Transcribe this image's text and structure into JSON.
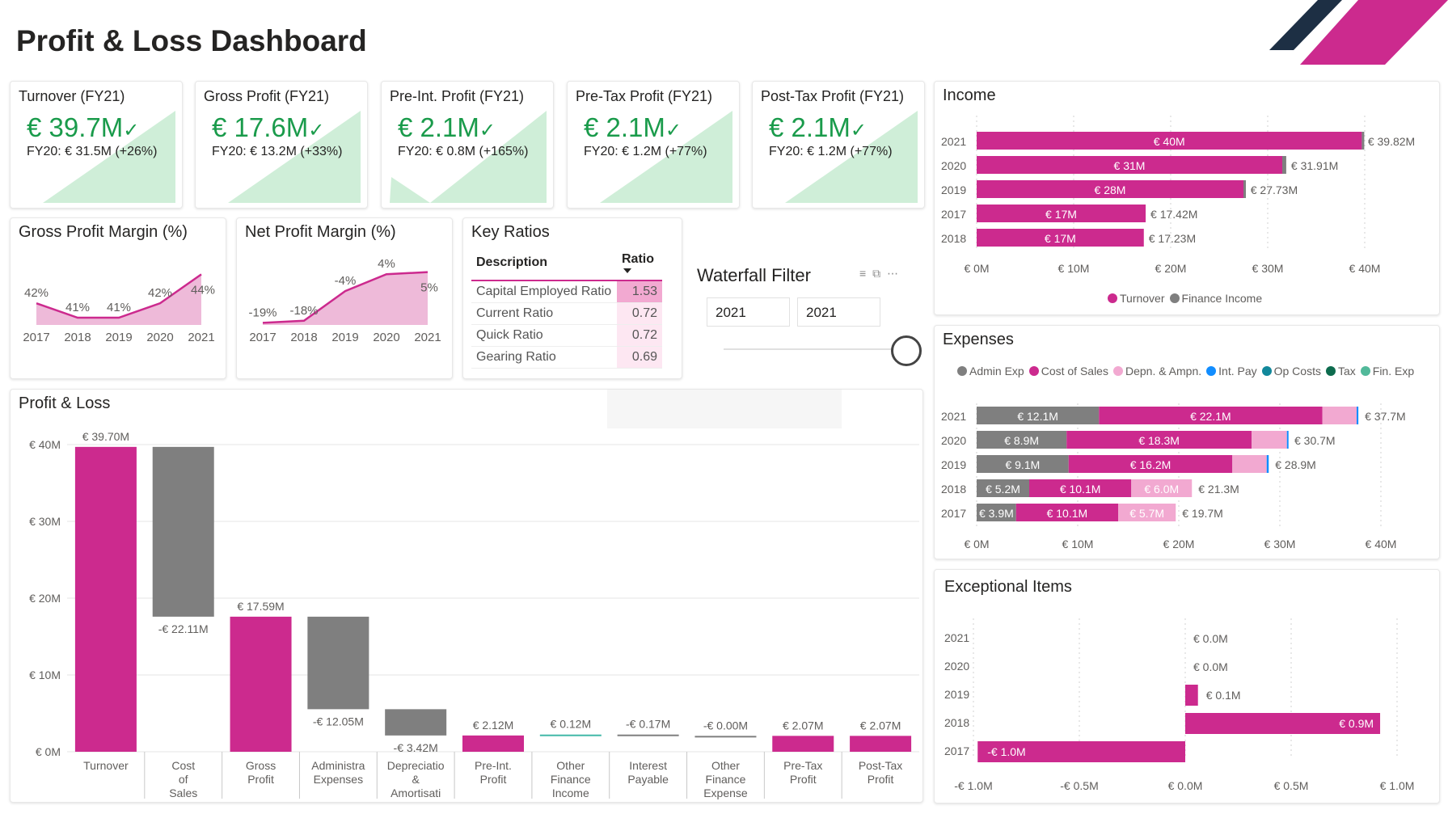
{
  "header": {
    "title": "Profit & Loss Dashboard",
    "accent_colors": [
      "#1d2f44",
      "#cc2a8e"
    ]
  },
  "kpis": [
    {
      "title": "Turnover (FY21)",
      "value": "€ 39.7M",
      "comparison": "FY20: € 31.5M (+26%)",
      "check_icon": "checkmark-icon"
    },
    {
      "title": "Gross Profit (FY21)",
      "value": "€ 17.6M",
      "comparison": "FY20: € 13.2M (+33%)",
      "check_icon": "checkmark-icon"
    },
    {
      "title": "Pre-Int. Profit (FY21)",
      "value": "€ 2.1M",
      "comparison": "FY20: € 0.8M (+165%)",
      "check_icon": "checkmark-icon"
    },
    {
      "title": "Pre-Tax Profit (FY21)",
      "value": "€ 2.1M",
      "comparison": "FY20: € 1.2M (+77%)",
      "check_icon": "checkmark-icon"
    },
    {
      "title": "Post-Tax Profit (FY21)",
      "value": "€ 2.1M",
      "comparison": "FY20: € 1.2M (+77%)",
      "check_icon": "checkmark-icon"
    }
  ],
  "colors": {
    "pink": "#cc2a8e",
    "pink_light": "#f2a9d1",
    "pink_area": "#e8a3cc",
    "grey": "#7f7f7f",
    "green": "#1a9b4b",
    "green_area": "#cfeed8",
    "teal_line": "#41b8a8"
  },
  "gross_margin": {
    "title": "Gross Profit Margin (%)",
    "years": [
      "2017",
      "2018",
      "2019",
      "2020",
      "2021"
    ],
    "values": [
      42,
      41,
      41,
      42,
      44
    ],
    "labels": [
      "42%",
      "41%",
      "41%",
      "42%",
      "44%"
    ]
  },
  "net_margin": {
    "title": "Net Profit Margin (%)",
    "years": [
      "2017",
      "2018",
      "2019",
      "2020",
      "2021"
    ],
    "values": [
      -19,
      -18,
      -4,
      4,
      5
    ],
    "labels": [
      "-19%",
      "-18%",
      "-4%",
      "4%",
      "5%"
    ]
  },
  "key_ratios": {
    "title": "Key Ratios",
    "col_description": "Description",
    "col_ratio": "Ratio",
    "sort_icon": "sort-descending-icon",
    "rows": [
      {
        "description": "Capital Employed Ratio",
        "ratio": "1.53"
      },
      {
        "description": "Current Ratio",
        "ratio": "0.72"
      },
      {
        "description": "Quick Ratio",
        "ratio": "0.72"
      },
      {
        "description": "Gearing Ratio",
        "ratio": "0.69"
      }
    ]
  },
  "waterfall_filter": {
    "title": "Waterfall Filter",
    "from_value": "2021",
    "to_value": "2021",
    "icons": [
      "filter-icon",
      "focus-mode-icon",
      "more-options-icon"
    ]
  },
  "income": {
    "title": "Income",
    "legend": [
      {
        "name": "Turnover",
        "color": "#cc2a8e"
      },
      {
        "name": "Finance Income",
        "color": "#7f7f7f"
      }
    ],
    "x_ticks": [
      "€ 0M",
      "€ 10M",
      "€ 20M",
      "€ 30M",
      "€ 40M"
    ],
    "rows": [
      {
        "year": "2021",
        "turnover": 39.7,
        "finance": 0.12,
        "inner_label": "€ 40M",
        "total_label": "€ 39.82M"
      },
      {
        "year": "2020",
        "turnover": 31.5,
        "finance": 0.41,
        "inner_label": "€ 31M",
        "total_label": "€ 31.91M"
      },
      {
        "year": "2019",
        "turnover": 27.5,
        "finance": 0.23,
        "inner_label": "€ 28M",
        "total_label": "€ 27.73M"
      },
      {
        "year": "2017",
        "turnover": 17.42,
        "finance": 0,
        "inner_label": "€ 17M",
        "total_label": "€ 17.42M"
      },
      {
        "year": "2018",
        "turnover": 17.23,
        "finance": 0,
        "inner_label": "€ 17M",
        "total_label": "€ 17.23M"
      }
    ]
  },
  "expenses": {
    "title": "Expenses",
    "legend": [
      {
        "name": "Admin Exp",
        "color": "#7f7f7f"
      },
      {
        "name": "Cost of Sales",
        "color": "#cc2a8e"
      },
      {
        "name": "Depn. & Ampn.",
        "color": "#f2a9d1"
      },
      {
        "name": "Int. Pay",
        "color": "#118dff"
      },
      {
        "name": "Op Costs",
        "color": "#12889b"
      },
      {
        "name": "Tax",
        "color": "#0d6b4e"
      },
      {
        "name": "Fin. Exp",
        "color": "#52b99a"
      }
    ],
    "x_ticks": [
      "€ 0M",
      "€ 10M",
      "€ 20M",
      "€ 30M",
      "€ 40M"
    ],
    "rows": [
      {
        "year": "2021",
        "admin": 12.1,
        "cos": 22.1,
        "depn": 3.4,
        "intpay": 0.17,
        "admin_label": "€ 12.1M",
        "cos_label": "€ 22.1M",
        "depn_label": "",
        "total_label": "€ 37.7M"
      },
      {
        "year": "2020",
        "admin": 8.9,
        "cos": 18.3,
        "depn": 3.5,
        "intpay": 0.1,
        "admin_label": "€ 8.9M",
        "cos_label": "€ 18.3M",
        "depn_label": "",
        "total_label": "€ 30.7M"
      },
      {
        "year": "2019",
        "admin": 9.1,
        "cos": 16.2,
        "depn": 3.4,
        "intpay": 0.2,
        "admin_label": "€ 9.1M",
        "cos_label": "€ 16.2M",
        "depn_label": "",
        "total_label": "€ 28.9M"
      },
      {
        "year": "2018",
        "admin": 5.2,
        "cos": 10.1,
        "depn": 6.0,
        "intpay": 0,
        "admin_label": "€ 5.2M",
        "cos_label": "€ 10.1M",
        "depn_label": "€ 6.0M",
        "total_label": "€ 21.3M"
      },
      {
        "year": "2017",
        "admin": 3.9,
        "cos": 10.1,
        "depn": 5.7,
        "intpay": 0,
        "admin_label": "€ 3.9M",
        "cos_label": "€ 10.1M",
        "depn_label": "€ 5.7M",
        "total_label": "€ 19.7M"
      }
    ]
  },
  "exceptional": {
    "title": "Exceptional Items",
    "x_ticks": [
      "-€ 1.0M",
      "-€ 0.5M",
      "€ 0.0M",
      "€ 0.5M",
      "€ 1.0M"
    ],
    "rows": [
      {
        "year": "2021",
        "value": 0.0,
        "label": "€ 0.0M"
      },
      {
        "year": "2020",
        "value": 0.0,
        "label": "€ 0.0M"
      },
      {
        "year": "2019",
        "value": 0.06,
        "label": "€ 0.1M"
      },
      {
        "year": "2018",
        "value": 0.92,
        "label": "€ 0.9M"
      },
      {
        "year": "2017",
        "value": -0.98,
        "label": "-€ 1.0M"
      }
    ]
  },
  "chart_data": {
    "type": "bar",
    "title": "Profit & Loss",
    "subtype": "waterfall",
    "ylim": [
      0,
      40
    ],
    "y_ticks": [
      "€ 0M",
      "€ 10M",
      "€ 20M",
      "€ 30M",
      "€ 40M"
    ],
    "categories": [
      "Turnover",
      "Cost of Sales",
      "Gross Profit",
      "Administra Expenses",
      "Depreciatio & Amortisati",
      "Pre-Int. Profit",
      "Other Finance Income",
      "Interest Payable",
      "Other Finance Expense",
      "Pre-Tax Profit",
      "Post-Tax Profit"
    ],
    "bars": [
      {
        "kind": "total",
        "start": 0,
        "end": 39.7,
        "label": "€ 39.70M"
      },
      {
        "kind": "delta",
        "start": 39.7,
        "end": 17.59,
        "label": "-€ 22.11M"
      },
      {
        "kind": "total",
        "start": 0,
        "end": 17.59,
        "label": "€ 17.59M"
      },
      {
        "kind": "delta",
        "start": 17.59,
        "end": 5.54,
        "label": "-€ 12.05M"
      },
      {
        "kind": "delta",
        "start": 5.54,
        "end": 2.12,
        "label": "-€ 3.42M"
      },
      {
        "kind": "total",
        "start": 0,
        "end": 2.12,
        "label": "€ 2.12M"
      },
      {
        "kind": "inc",
        "start": 2.12,
        "end": 2.24,
        "label": "€ 0.12M"
      },
      {
        "kind": "delta",
        "start": 2.24,
        "end": 2.07,
        "label": "-€ 0.17M"
      },
      {
        "kind": "delta",
        "start": 2.07,
        "end": 2.07,
        "label": "-€ 0.00M"
      },
      {
        "kind": "total",
        "start": 0,
        "end": 2.07,
        "label": "€ 2.07M"
      },
      {
        "kind": "total",
        "start": 0,
        "end": 2.07,
        "label": "€ 2.07M"
      }
    ]
  }
}
